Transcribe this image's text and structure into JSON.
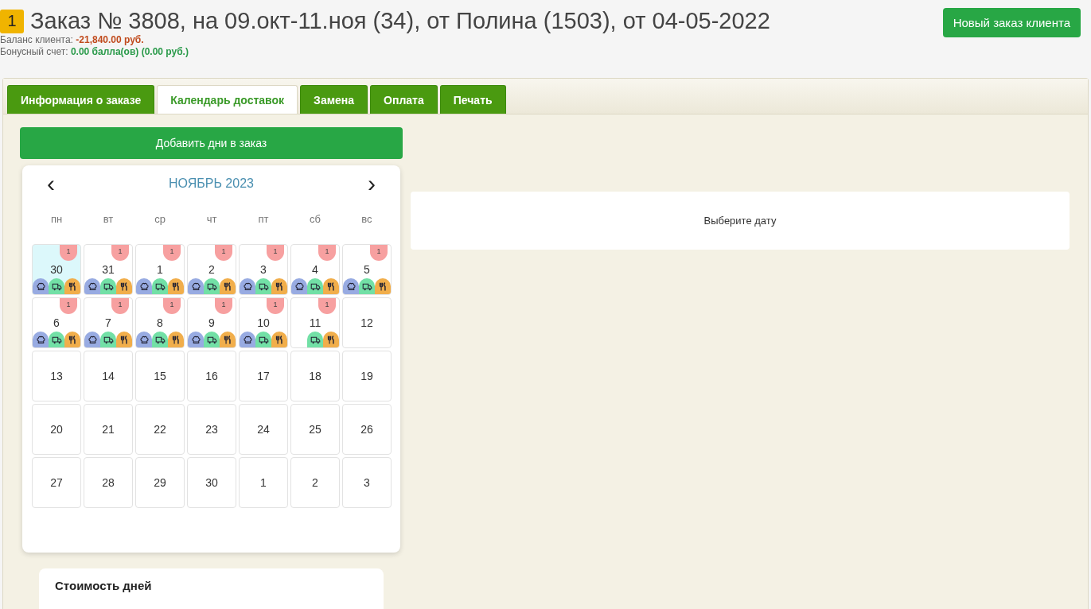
{
  "header": {
    "badge": "1",
    "title": "Заказ № 3808, на 09.окт-11.ноя (34), от Полина (1503), от 04-05-2022",
    "balance_label": "Баланс клиента:",
    "balance_value": "-21,840.00 руб.",
    "bonus_label": "Бонусный счет:",
    "bonus_value": "0.00 балла(ов) (0.00 руб.)",
    "new_order_button": "Новый заказ клиента"
  },
  "tabs": [
    {
      "label": "Информация о заказе",
      "selected": false
    },
    {
      "label": "Календарь доставок",
      "selected": true
    },
    {
      "label": "Замена",
      "selected": false
    },
    {
      "label": "Оплата",
      "selected": false
    },
    {
      "label": "Печать",
      "selected": false
    }
  ],
  "add_days_button": "Добавить дни в заказ",
  "calendar": {
    "month": "НОЯБРЬ 2023",
    "prev": "‹",
    "next": "›",
    "weekdays": [
      "пн",
      "вт",
      "ср",
      "чт",
      "пт",
      "сб",
      "вс"
    ],
    "days": [
      {
        "day": "30",
        "selected": true,
        "count": "1",
        "icons": [
          {
            "kind": "chef"
          },
          {
            "kind": "truck"
          },
          {
            "kind": "food"
          }
        ]
      },
      {
        "day": "31",
        "selected": false,
        "count": "1",
        "icons": [
          {
            "kind": "chef"
          },
          {
            "kind": "truck"
          },
          {
            "kind": "food"
          }
        ]
      },
      {
        "day": "1",
        "selected": false,
        "count": "1",
        "icons": [
          {
            "kind": "chef"
          },
          {
            "kind": "truck"
          },
          {
            "kind": "food"
          }
        ]
      },
      {
        "day": "2",
        "selected": false,
        "count": "1",
        "icons": [
          {
            "kind": "chef"
          },
          {
            "kind": "truck"
          },
          {
            "kind": "food"
          }
        ]
      },
      {
        "day": "3",
        "selected": false,
        "count": "1",
        "icons": [
          {
            "kind": "chef"
          },
          {
            "kind": "truck"
          },
          {
            "kind": "food"
          }
        ]
      },
      {
        "day": "4",
        "selected": false,
        "count": "1",
        "icons": [
          {
            "kind": "chef"
          },
          {
            "kind": "truck"
          },
          {
            "kind": "food"
          }
        ]
      },
      {
        "day": "5",
        "selected": false,
        "count": "1",
        "icons": [
          {
            "kind": "chef"
          },
          {
            "kind": "truck"
          },
          {
            "kind": "food"
          }
        ]
      },
      {
        "day": "6",
        "selected": false,
        "count": "1",
        "icons": [
          {
            "kind": "chef"
          },
          {
            "kind": "truck"
          },
          {
            "kind": "food"
          }
        ]
      },
      {
        "day": "7",
        "selected": false,
        "count": "1",
        "icons": [
          {
            "kind": "chef"
          },
          {
            "kind": "truck"
          },
          {
            "kind": "food"
          }
        ]
      },
      {
        "day": "8",
        "selected": false,
        "count": "1",
        "icons": [
          {
            "kind": "chef"
          },
          {
            "kind": "truck"
          },
          {
            "kind": "food"
          }
        ]
      },
      {
        "day": "9",
        "selected": false,
        "count": "1",
        "icons": [
          {
            "kind": "chef"
          },
          {
            "kind": "truck"
          },
          {
            "kind": "food"
          }
        ]
      },
      {
        "day": "10",
        "selected": false,
        "count": "1",
        "icons": [
          {
            "kind": "chef"
          },
          {
            "kind": "truck"
          },
          {
            "kind": "food"
          }
        ]
      },
      {
        "day": "11",
        "selected": false,
        "count": "1",
        "icons": [
          {
            "kind": "truck"
          },
          {
            "kind": "food"
          }
        ]
      },
      {
        "day": "12",
        "selected": false
      },
      {
        "day": "13",
        "selected": false
      },
      {
        "day": "14",
        "selected": false
      },
      {
        "day": "15",
        "selected": false
      },
      {
        "day": "16",
        "selected": false
      },
      {
        "day": "17",
        "selected": false
      },
      {
        "day": "18",
        "selected": false
      },
      {
        "day": "19",
        "selected": false
      },
      {
        "day": "20",
        "selected": false
      },
      {
        "day": "21",
        "selected": false
      },
      {
        "day": "22",
        "selected": false
      },
      {
        "day": "23",
        "selected": false
      },
      {
        "day": "24",
        "selected": false
      },
      {
        "day": "25",
        "selected": false
      },
      {
        "day": "26",
        "selected": false
      },
      {
        "day": "27",
        "selected": false
      },
      {
        "day": "28",
        "selected": false
      },
      {
        "day": "29",
        "selected": false
      },
      {
        "day": "30",
        "selected": false
      },
      {
        "day": "1",
        "selected": false
      },
      {
        "day": "2",
        "selected": false
      },
      {
        "day": "3",
        "selected": false
      }
    ]
  },
  "day_costs_title": "Стоимость дней",
  "detail_message": "Выберите дату"
}
